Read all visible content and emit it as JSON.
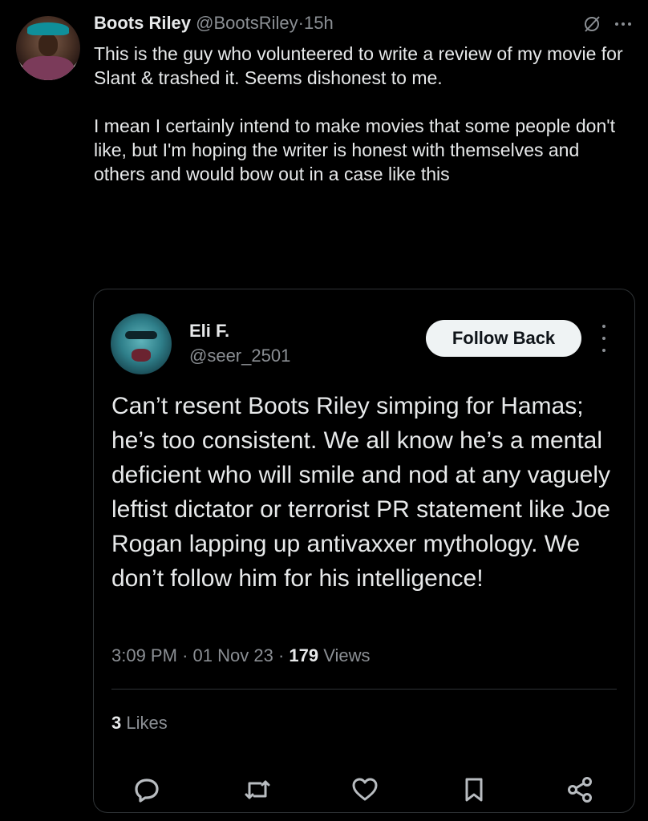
{
  "tweet": {
    "author_name": "Boots Riley",
    "author_handle": "@BootsRiley",
    "time": "15h",
    "paragraphs": [
      "This is the guy who volunteered to write a review of my movie for Slant & trashed it. Seems dishonest to me.",
      "I mean I certainly intend to make movies that some people don't like, but I'm hoping the writer is honest with themselves and others and would bow out in a case like this"
    ]
  },
  "quote": {
    "author_name": "Eli F.",
    "author_handle": "@seer_2501",
    "follow_label": "Follow Back",
    "text": "Can’t resent Boots Riley simping for Hamas; he’s too consistent. We all know he’s a mental deficient who will smile and nod at any vaguely leftist dictator or terrorist PR statement like Joe Rogan lapping up antivaxxer mythology. We don’t follow him for his intelligence!",
    "time": "3:09 PM",
    "date": "01 Nov 23",
    "views_count": "179",
    "views_label": "Views",
    "likes_count": "3",
    "likes_label": "Likes"
  },
  "icons": {
    "grok": "grok-icon",
    "more": "more-icon",
    "reply": "reply-icon",
    "repost": "repost-icon",
    "like": "like-icon",
    "bookmark": "bookmark-icon",
    "share": "share-icon"
  },
  "colors": {
    "background": "#000000",
    "text": "#e7e9ea",
    "muted": "#8b8f94",
    "border": "#2f3336",
    "button_bg": "#eff3f4"
  }
}
